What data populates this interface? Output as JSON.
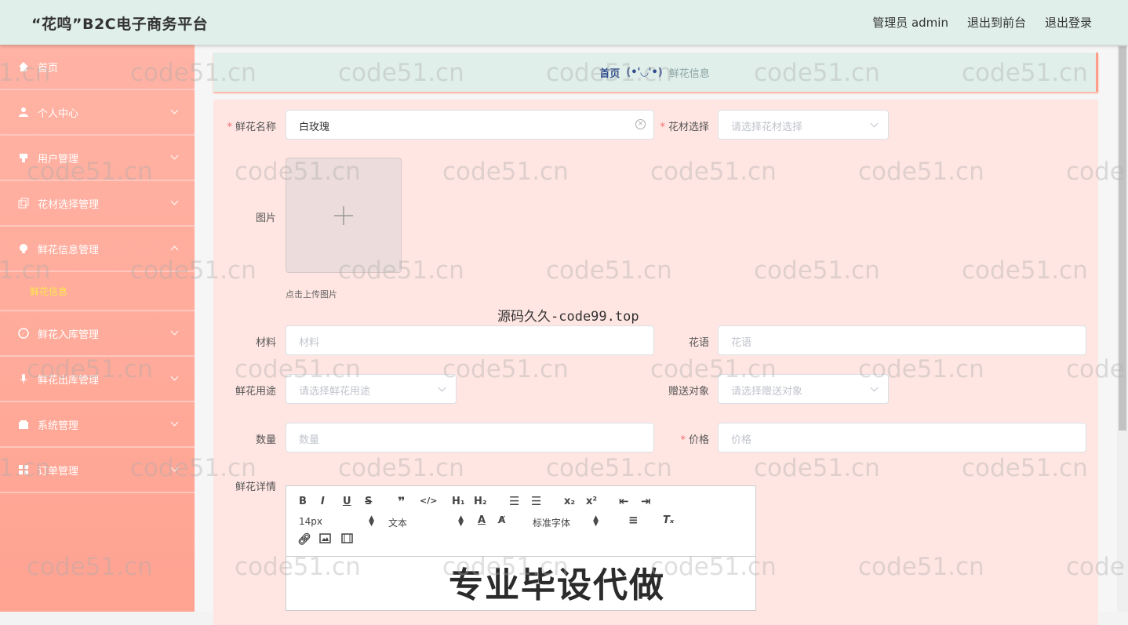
{
  "header": {
    "title": "“花鸣”B2C电子商务平台",
    "admin_label": "管理员 admin",
    "to_front": "退出到前台",
    "logout": "退出登录"
  },
  "sidebar": {
    "items": [
      {
        "label": "首页",
        "icon": "home-icon"
      },
      {
        "label": "个人中心",
        "icon": "user-icon"
      },
      {
        "label": "用户管理",
        "icon": "users-icon"
      },
      {
        "label": "花材选择管理",
        "icon": "copy-icon"
      },
      {
        "label": "鲜花信息管理",
        "icon": "bulb-icon"
      },
      {
        "label": "鲜花入库管理",
        "icon": "compass-icon"
      },
      {
        "label": "鲜花出库管理",
        "icon": "mic-icon"
      },
      {
        "label": "系统管理",
        "icon": "wallet-icon"
      },
      {
        "label": "订单管理",
        "icon": "grid-icon"
      }
    ],
    "sub_item": "鲜花信息"
  },
  "breadcrumb": {
    "home": "首页",
    "sep": "(•'◡'•)",
    "current": "鲜花信息"
  },
  "form": {
    "name_label": "鲜花名称",
    "name_value": "白玫瑰",
    "material_select_label": "花材选择",
    "material_select_placeholder": "请选择花材选择",
    "image_label": "图片",
    "upload_hint": "点击上传图片",
    "materials_label": "材料",
    "materials_placeholder": "材料",
    "flower_language_label": "花语",
    "flower_language_placeholder": "花语",
    "usage_label": "鲜花用途",
    "usage_placeholder": "请选择鲜花用途",
    "recipient_label": "赠送对象",
    "recipient_placeholder": "请选择赠送对象",
    "quantity_label": "数量",
    "quantity_placeholder": "数量",
    "price_label": "价格",
    "price_placeholder": "价格",
    "details_label": "鲜花详情"
  },
  "editor": {
    "font_size": "14px",
    "text_type": "文本",
    "font_family": "标准字体"
  },
  "overlay": {
    "source": "源码久久-code99.top",
    "promo": "专业毕设代做",
    "watermark": "code51.cn"
  }
}
